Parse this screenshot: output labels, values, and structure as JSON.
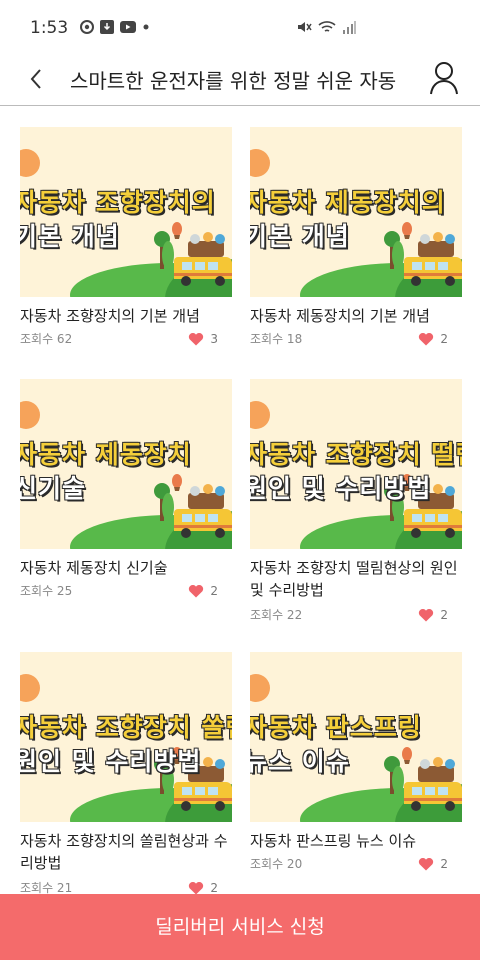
{
  "status_bar": {
    "time": "1:53"
  },
  "header": {
    "title": "스마트한 운전자를 위한 정말 쉬운 자동"
  },
  "cards": [
    {
      "line1": "자동차 조향장치의",
      "line2": "기본 개념",
      "title": "자동차 조향장치의 기본 개념",
      "views": "조회수 62",
      "likes": "3"
    },
    {
      "line1": "자동차 제동장치의",
      "line2": "기본 개념",
      "title": "자동차 제동장치의 기본 개념",
      "views": "조회수 18",
      "likes": "2"
    },
    {
      "line1": "자동차 제동장치",
      "line2": "신기술",
      "title": "자동차 제동장치 신기술",
      "views": "조회수 25",
      "likes": "2"
    },
    {
      "line1": "자동차 조향장치 떨림현상의",
      "line2": "원인 및 수리방법",
      "title": "자동차 조향장치 떨림현상의 원인 및 수리방법",
      "views": "조회수 22",
      "likes": "2"
    },
    {
      "line1": "자동차 조향장치 쏠림현상의",
      "line2": "원인 및 수리방법",
      "title": "자동차 조향장치의 쏠림현상과 수리방법",
      "views": "조회수 21",
      "likes": "2"
    },
    {
      "line1": "자동차 판스프링",
      "line2": "뉴스 이슈",
      "title": "자동차 판스프링 뉴스 이슈",
      "views": "조회수 20",
      "likes": "2"
    }
  ],
  "cta": {
    "label": "딜리버리 서비스 신청"
  },
  "colors": {
    "accent": "#f46b6b",
    "heart": "#f0636a",
    "thumb_bg": "#fef3d8"
  }
}
